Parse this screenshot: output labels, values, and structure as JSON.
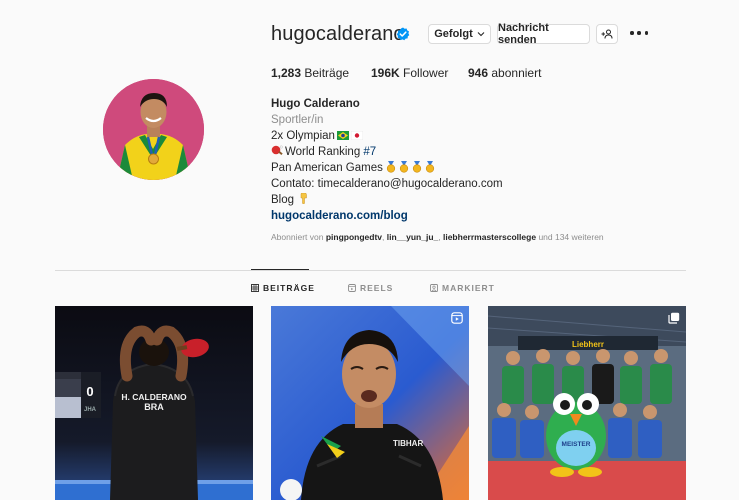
{
  "profile": {
    "username": "hugocalderano",
    "verified": true,
    "avatar": "profile-photo"
  },
  "actions": {
    "follow_label": "Gefolgt",
    "message_label": "Nachricht senden",
    "suggest_icon": "add-person-icon",
    "more_icon": "more-icon"
  },
  "stats": {
    "posts_count": "1,283",
    "posts_label": "Beiträge",
    "followers_count": "196K",
    "followers_label": "Follower",
    "following_count": "946",
    "following_label": "abonniert"
  },
  "bio": {
    "name": "Hugo Calderano",
    "category": "Sportler/in",
    "line1": "2x Olympian",
    "line2_prefix": "World Ranking ",
    "line2_rank": "#7",
    "line3": "Pan American Games",
    "line4": "Contato: timecalderano@hugocalderano.com",
    "line5": "Blog",
    "link": "hugocalderano.com/blog"
  },
  "followed_by": {
    "prefix": "Abonniert von",
    "user1": "pingpongedtv",
    "user2": "lin__yun_ju_",
    "user3": "liebherrmasterscollege",
    "suffix": "und 134 weiteren"
  },
  "tabs": [
    {
      "label": "BEITRÄGE",
      "icon": "grid-icon",
      "active": true
    },
    {
      "label": "REELS",
      "icon": "reels-icon",
      "active": false
    },
    {
      "label": "MARKIERT",
      "icon": "tagged-icon",
      "active": false
    }
  ],
  "posts": {
    "post1_jersey_name": "H. CALDERANO",
    "post1_jersey_country": "BRA",
    "post1_scoreboard_score": "0",
    "post1_scoreboard_code": "JHA",
    "post2_shirt_brand": "TIBHAR",
    "post3_banner_text": "Liebherr",
    "post3_mascot_text": "MEISTER"
  },
  "colors": {
    "verified": "#0095f6",
    "link": "#00376b",
    "muted": "#8e8e8e",
    "avatar_bg": "#c93a6d"
  }
}
